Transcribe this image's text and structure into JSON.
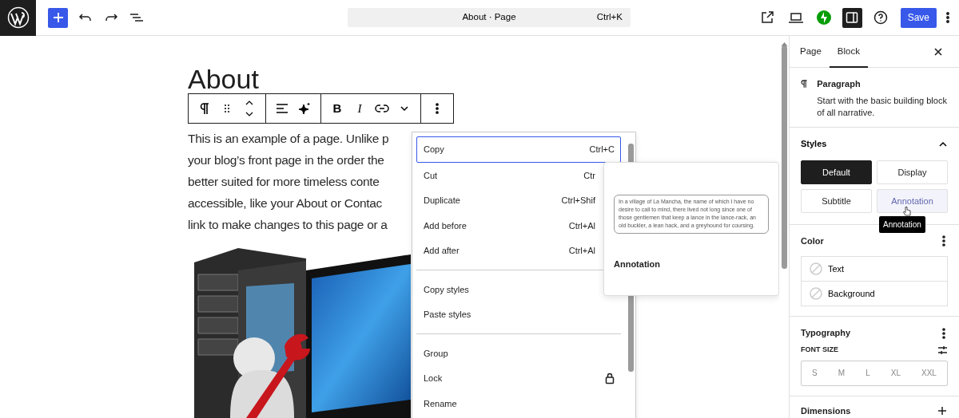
{
  "topbar": {
    "command_title": "About · Page",
    "command_shortcut": "Ctrl+K",
    "sidebar_open": true,
    "save": "Save"
  },
  "editor": {
    "heading": "About",
    "paragraph": "This is an example of a page. Unlike p\nyour blog’s front page in the order the\nbetter suited for more timeless conte\naccessible, like your About or Contac\nlink to make changes to this page or a",
    "toolbar": {
      "bold": "B",
      "italic": "I"
    }
  },
  "block_menu": {
    "groups": [
      [
        {
          "label": "Copy",
          "kind": "shortcut",
          "shortcut": "Ctrl+C",
          "focused": true
        },
        {
          "label": "Cut",
          "kind": "shortcut",
          "shortcut": "Ctr",
          "focused": false
        },
        {
          "label": "Duplicate",
          "kind": "shortcut",
          "shortcut": "Ctrl+Shif",
          "focused": false
        },
        {
          "label": "Add before",
          "kind": "shortcut",
          "shortcut": "Ctrl+Al",
          "focused": false
        },
        {
          "label": "Add after",
          "kind": "shortcut",
          "shortcut": "Ctrl+Al",
          "focused": false
        }
      ],
      [
        {
          "label": "Copy styles",
          "kind": "plain",
          "focused": false
        },
        {
          "label": "Paste styles",
          "kind": "plain",
          "focused": false
        }
      ],
      [
        {
          "label": "Group",
          "kind": "plain",
          "focused": false
        },
        {
          "label": "Lock",
          "kind": "lock",
          "focused": false
        },
        {
          "label": "Rename",
          "kind": "plain",
          "focused": false
        }
      ]
    ]
  },
  "style_preview": {
    "sample": "In a village of La Mancha, the name of which I have no desire to call to mind, there lived not long since one of those gentlemen that keep a lance in the lance-rack, an old buckler, a lean hack, and a greyhound for coursing.",
    "label": "Annotation"
  },
  "sidebar": {
    "tabs": [
      {
        "label": "Page",
        "selected": false
      },
      {
        "label": "Block",
        "selected": true
      }
    ],
    "block": {
      "title": "Paragraph",
      "description": "Start with the basic building block of all narrative."
    },
    "styles": {
      "title": "Styles",
      "expanded": true,
      "options": [
        {
          "label": "Default",
          "selected": true,
          "hovered": false
        },
        {
          "label": "Display",
          "selected": false,
          "hovered": false
        },
        {
          "label": "Subtitle",
          "selected": false,
          "hovered": false
        },
        {
          "label": "Annotation",
          "selected": false,
          "hovered": true
        }
      ],
      "tooltip": "Annotation"
    },
    "color": {
      "title": "Color",
      "items": [
        "Text",
        "Background"
      ]
    },
    "typography": {
      "title": "Typography",
      "font_size_label": "FONT SIZE",
      "sizes": [
        "S",
        "M",
        "L",
        "XL",
        "XXL"
      ]
    },
    "dimensions": {
      "title": "Dimensions"
    }
  }
}
